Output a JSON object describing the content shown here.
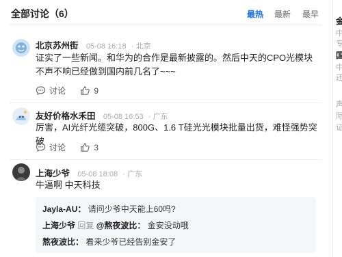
{
  "header": {
    "title": "全部讨论（6）",
    "sort_hot": "最热",
    "sort_new": "最新",
    "sort_new2": "最早"
  },
  "comments": [
    {
      "user": "北京苏州街",
      "time": "05-08 16:18",
      "location": "· 北京",
      "text": "证实了一些新闻。和华为的合作是最新披露的。然后中天的CPO光模块不声不响已经做到国内前几名了~~~",
      "discuss_label": "讨论",
      "likes": "9"
    },
    {
      "user": "友好价格水禾田",
      "time": "05-08 16:53",
      "location": "· 广东",
      "text": "厉害，AI光纤光缆突破，800G、1.6 T硅光光模块批量出货，难怪强势突破",
      "discuss_label": "讨论",
      "likes": "3"
    },
    {
      "user": "上海少爷",
      "time": "05-08 18:08",
      "location": "· 广东",
      "text": "牛逼啊 中天科技"
    }
  ],
  "replies": [
    {
      "user": "Jayla-AU：",
      "text": "请问少爷中天能上60吗?"
    },
    {
      "user": "上海少爷",
      "verb": "回复",
      "target": "@熬夜波比：",
      "text": "金安没动哦"
    },
    {
      "user": "熬夜波比：",
      "text": "看来少爷已经告别金安了"
    }
  ],
  "side_panel": {
    "chars": [
      "金",
      "中",
      "专",
      "国",
      "中",
      "还",
      "声",
      "际",
      "证"
    ]
  }
}
